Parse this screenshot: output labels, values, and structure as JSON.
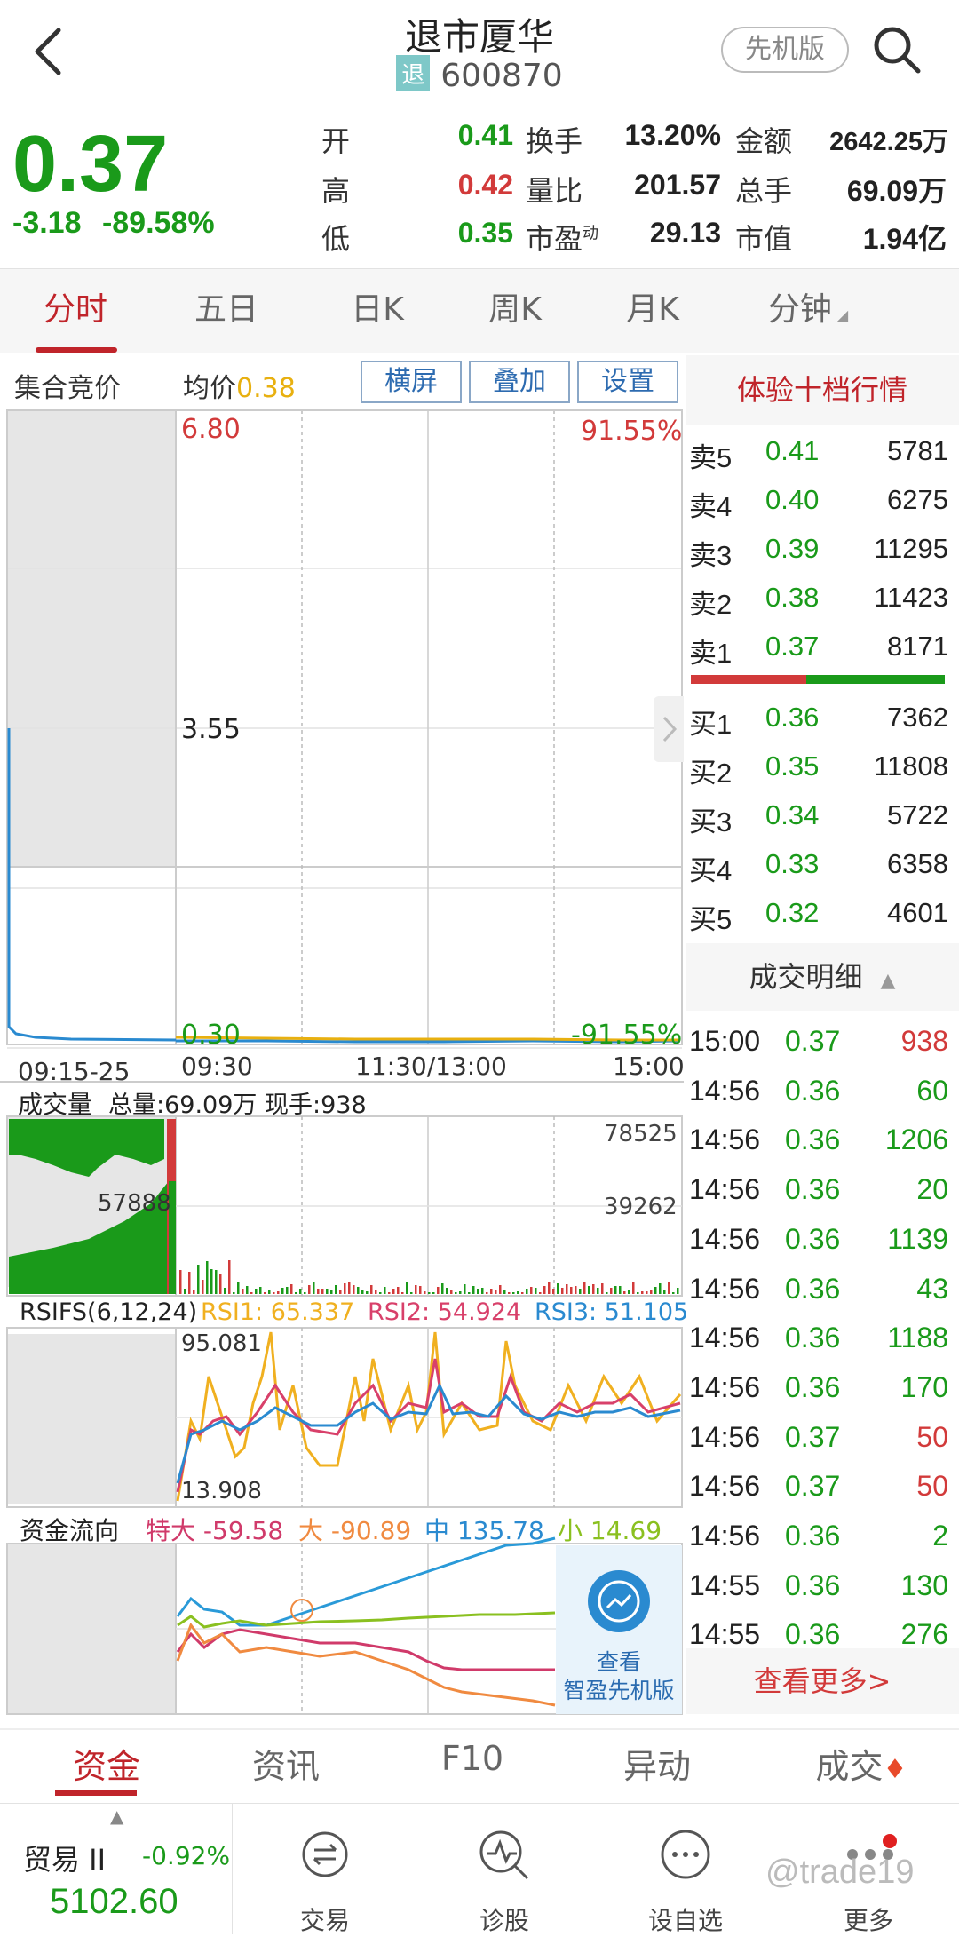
{
  "header": {
    "title": "退市厦华",
    "badge": "退",
    "code": "600870",
    "pro_button": "先机版"
  },
  "quote": {
    "price": "0.37",
    "change": "-3.18",
    "change_pct": "-89.58%",
    "fields": [
      {
        "label": "开",
        "value": "0.41",
        "color": "green"
      },
      {
        "label": "换手",
        "value": "13.20%",
        "color": "black"
      },
      {
        "label": "金额",
        "value": "2642.25万",
        "color": "black"
      },
      {
        "label": "高",
        "value": "0.42",
        "color": "red"
      },
      {
        "label": "量比",
        "value": "201.57",
        "color": "black"
      },
      {
        "label": "总手",
        "value": "69.09万",
        "color": "black"
      },
      {
        "label": "低",
        "value": "0.35",
        "color": "green"
      },
      {
        "label": "市盈",
        "label_sup": "动",
        "value": "29.13",
        "color": "black"
      },
      {
        "label": "市值",
        "value": "1.94亿",
        "color": "black"
      }
    ]
  },
  "tabs": [
    "分时",
    "五日",
    "日K",
    "周K",
    "月K",
    "分钟"
  ],
  "chart": {
    "auction_label": "集合竞价",
    "avg_label": "均价",
    "avg_value": "0.38",
    "buttons": [
      "横屏",
      "叠加",
      "设置"
    ],
    "price_max": "6.80",
    "price_mid": "3.55",
    "price_min": "0.30",
    "pct_max": "91.55%",
    "pct_min": "-91.55%",
    "time_labels": [
      "09:15-25",
      "09:30",
      "11:30/13:00",
      "15:00"
    ],
    "volume_title": "成交量",
    "volume_total": "总量:69.09万",
    "volume_now": "现手:938",
    "vol_max": "78525",
    "vol_mid": "39262",
    "vol_auction": "57888",
    "rsi_title": "RSIFS(6,12,24)",
    "rsi1": "RSI1: 65.337",
    "rsi2": "RSI2: 54.924",
    "rsi3": "RSI3: 51.105",
    "rsi_max": "95.081",
    "rsi_min": "13.908",
    "flow_title": "资金流向",
    "flow_xl": "特大 -59.58",
    "flow_l": "大 -90.89",
    "flow_m": "中 135.78",
    "flow_s": "小 14.69",
    "promo_line1": "查看",
    "promo_line2": "智盈先机版"
  },
  "orderbook": {
    "title": "体验十档行情",
    "asks": [
      {
        "label": "卖5",
        "price": "0.41",
        "vol": "5781"
      },
      {
        "label": "卖4",
        "price": "0.40",
        "vol": "6275"
      },
      {
        "label": "卖3",
        "price": "0.39",
        "vol": "11295"
      },
      {
        "label": "卖2",
        "price": "0.38",
        "vol": "11423"
      },
      {
        "label": "卖1",
        "price": "0.37",
        "vol": "8171"
      }
    ],
    "bids": [
      {
        "label": "买1",
        "price": "0.36",
        "vol": "7362"
      },
      {
        "label": "买2",
        "price": "0.35",
        "vol": "11808"
      },
      {
        "label": "买3",
        "price": "0.34",
        "vol": "5722"
      },
      {
        "label": "买4",
        "price": "0.33",
        "vol": "6358"
      },
      {
        "label": "买5",
        "price": "0.32",
        "vol": "4601"
      }
    ],
    "trades_title": "成交明细",
    "trades": [
      {
        "time": "15:00",
        "price": "0.37",
        "vol": "938",
        "color": "red"
      },
      {
        "time": "14:56",
        "price": "0.36",
        "vol": "60",
        "color": "green"
      },
      {
        "time": "14:56",
        "price": "0.36",
        "vol": "1206",
        "color": "green"
      },
      {
        "time": "14:56",
        "price": "0.36",
        "vol": "20",
        "color": "green"
      },
      {
        "time": "14:56",
        "price": "0.36",
        "vol": "1139",
        "color": "green"
      },
      {
        "time": "14:56",
        "price": "0.36",
        "vol": "43",
        "color": "green"
      },
      {
        "time": "14:56",
        "price": "0.36",
        "vol": "1188",
        "color": "green"
      },
      {
        "time": "14:56",
        "price": "0.36",
        "vol": "170",
        "color": "green"
      },
      {
        "time": "14:56",
        "price": "0.37",
        "vol": "50",
        "color": "red"
      },
      {
        "time": "14:56",
        "price": "0.37",
        "vol": "50",
        "color": "red"
      },
      {
        "time": "14:56",
        "price": "0.36",
        "vol": "2",
        "color": "green"
      },
      {
        "time": "14:55",
        "price": "0.36",
        "vol": "130",
        "color": "green"
      },
      {
        "time": "14:55",
        "price": "0.36",
        "vol": "276",
        "color": "green"
      }
    ],
    "more": "查看更多>"
  },
  "bottom_tabs": [
    "资金",
    "资讯",
    "F10",
    "异动",
    "成交"
  ],
  "bottom_nav": {
    "index_name": "贸易 II",
    "index_pct": "-0.92%",
    "index_value": "5102.60",
    "items": [
      "交易",
      "诊股",
      "设自选",
      "更多"
    ]
  },
  "watermark": "@trade19",
  "colors": {
    "up": "#d23a3a",
    "down": "#1a9a1a",
    "accent": "#c0242a",
    "rsi1": "#f0b020",
    "rsi2": "#d8406a",
    "rsi3": "#2a8ad0"
  }
}
